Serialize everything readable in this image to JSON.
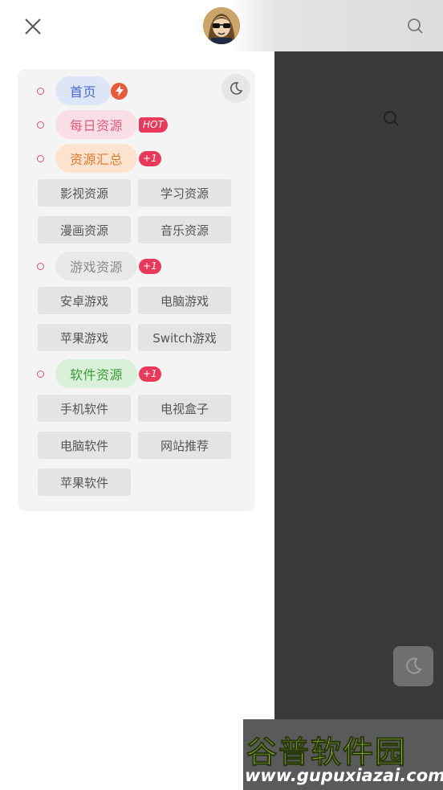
{
  "colors": {
    "accent_dot": "#d9498f",
    "badge": "#e8395a",
    "drawer_bg": "#ffffff",
    "card_bg": "#f4f4f4",
    "overlay": "#3a3a3a"
  },
  "topbar": {
    "close_icon": "close-icon",
    "avatar_icon": "avatar",
    "search_icon": "search-icon"
  },
  "menu": {
    "home": {
      "label": "首页",
      "badge_icon": "flash-icon"
    },
    "daily": {
      "label": "每日资源",
      "badge": "HOT"
    },
    "summary": {
      "label": "资源汇总",
      "badge": "+1",
      "items": [
        "影视资源",
        "学习资源",
        "漫画资源",
        "音乐资源"
      ]
    },
    "games": {
      "label": "游戏资源",
      "badge": "+1",
      "items": [
        "安卓游戏",
        "电脑游戏",
        "苹果游戏",
        "Switch游戏"
      ]
    },
    "software": {
      "label": "软件资源",
      "badge": "+1",
      "items": [
        "手机软件",
        "电视盒子",
        "电脑软件",
        "网站推荐",
        "苹果软件"
      ]
    }
  },
  "watermark": {
    "title": "谷普软件园",
    "url": "www.gupuxiazai.com"
  }
}
